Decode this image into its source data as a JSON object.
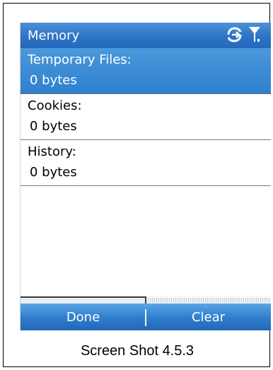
{
  "title_bar": {
    "title": "Memory",
    "icons": [
      "data-connection-icon",
      "signal-strength-icon"
    ]
  },
  "items": [
    {
      "label": "Temporary Files:",
      "value": "0 bytes",
      "selected": true
    },
    {
      "label": "Cookies:",
      "value": "0 bytes",
      "selected": false
    },
    {
      "label": "History:",
      "value": "0 bytes",
      "selected": false
    }
  ],
  "softkeys": {
    "left": "Done",
    "right": "Clear"
  },
  "caption": "Screen Shot 4.5.3",
  "colors": {
    "accent": "#2f76c7",
    "selected_background": "#3b8cd6"
  }
}
